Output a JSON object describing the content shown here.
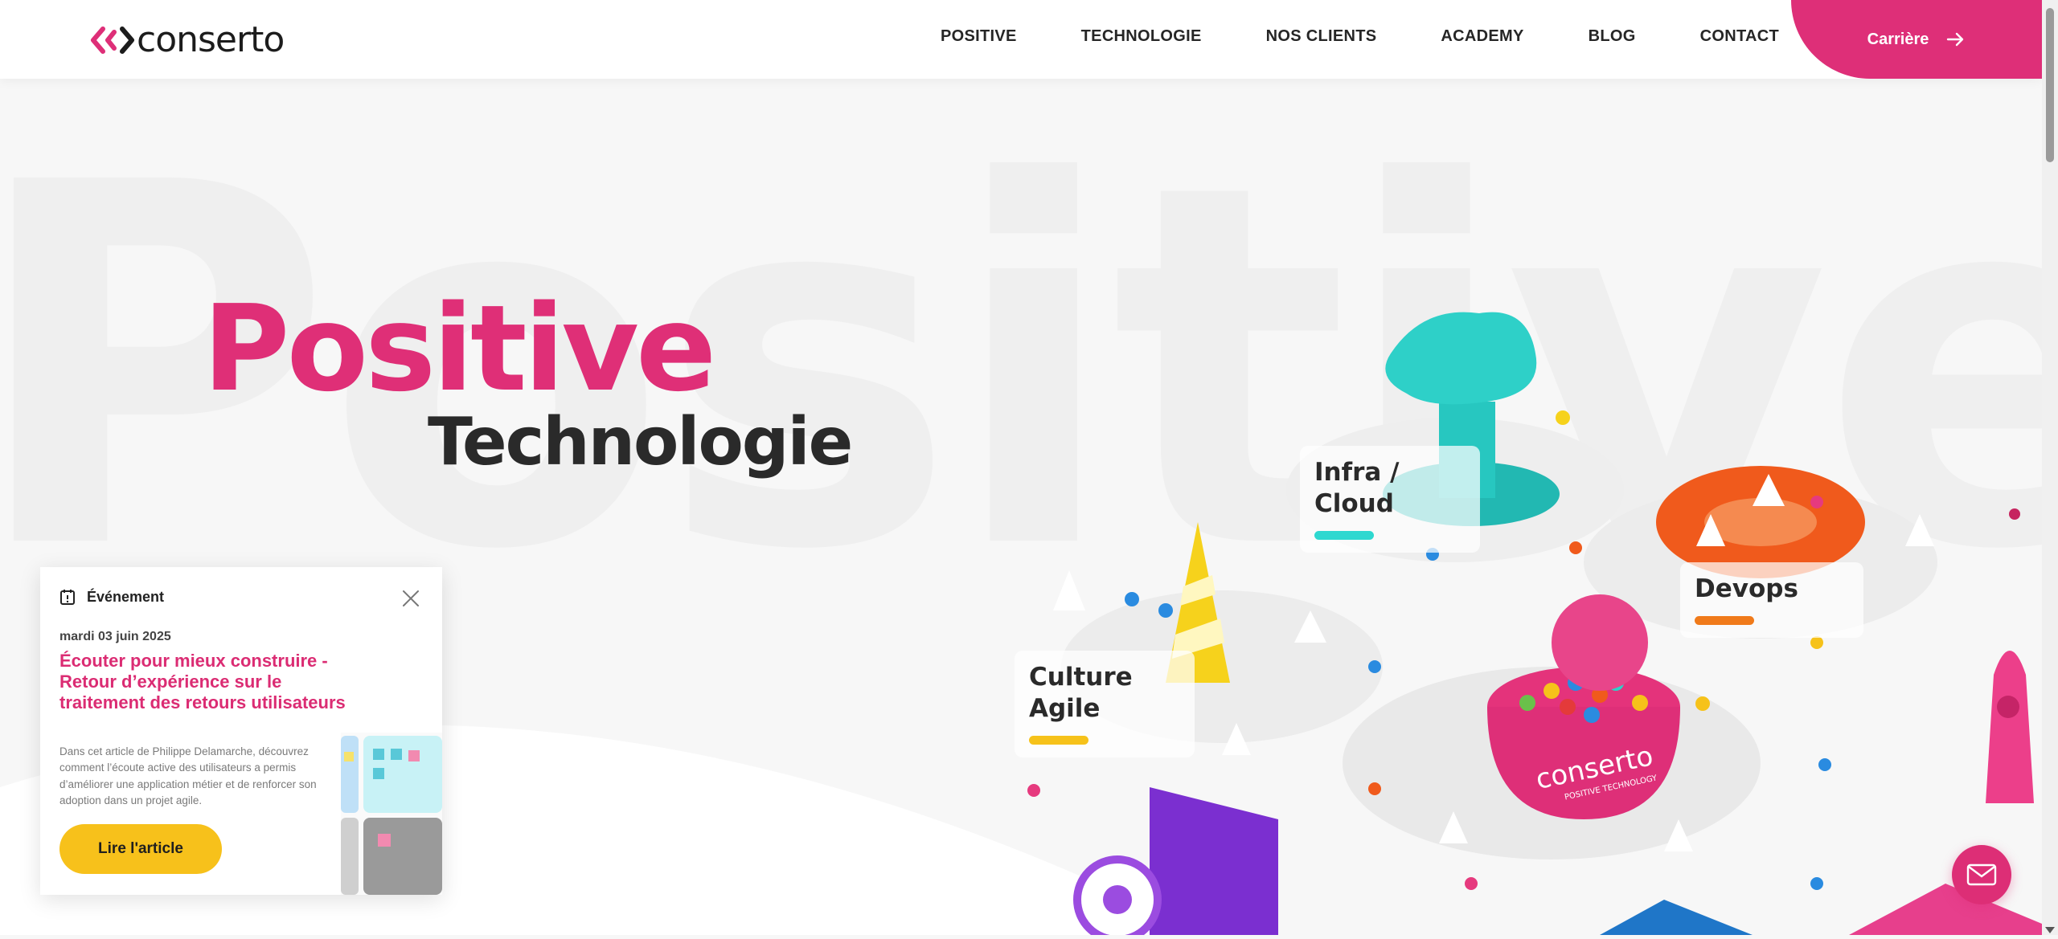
{
  "brand": {
    "name": "conserto",
    "accent": "#de2f78",
    "dark": "#2a2a2a"
  },
  "nav": {
    "items": [
      {
        "label": "POSITIVE"
      },
      {
        "label": "TECHNOLOGIE"
      },
      {
        "label": "NOS CLIENTS"
      },
      {
        "label": "ACADEMY"
      },
      {
        "label": "BLOG"
      },
      {
        "label": "CONTACT"
      }
    ],
    "career_label": "Carrière",
    "career_icon": "arrow-right-icon"
  },
  "hero": {
    "background_word": "Positive",
    "title_main": "Positive",
    "title_sub": "Technologie"
  },
  "illustration": {
    "tags": [
      {
        "label": "Infra /\nCloud",
        "color": "#2ed8d0"
      },
      {
        "label": "Devops",
        "color": "#f07a1a"
      },
      {
        "label": "Culture\nAgile",
        "color": "#f6c21a"
      }
    ],
    "brand_text": "conserto",
    "brand_sub": "POSITIVE TECHNOLOGY"
  },
  "event_card": {
    "category": "Événement",
    "category_icon": "calendar-icon",
    "date": "mardi 03 juin 2025",
    "title": "Écouter pour mieux construire - Retour d’expérience sur le traitement des retours utilisateurs",
    "body": "Dans cet article de Philippe Delamarche, découvrez comment l’écoute active des utilisateurs a permis d’améliorer une application métier et de renforcer son adoption dans un projet agile.",
    "button_label": "Lire l'article",
    "btn_color": "#f7c11b"
  },
  "floating": {
    "mail_icon": "envelope-icon"
  }
}
